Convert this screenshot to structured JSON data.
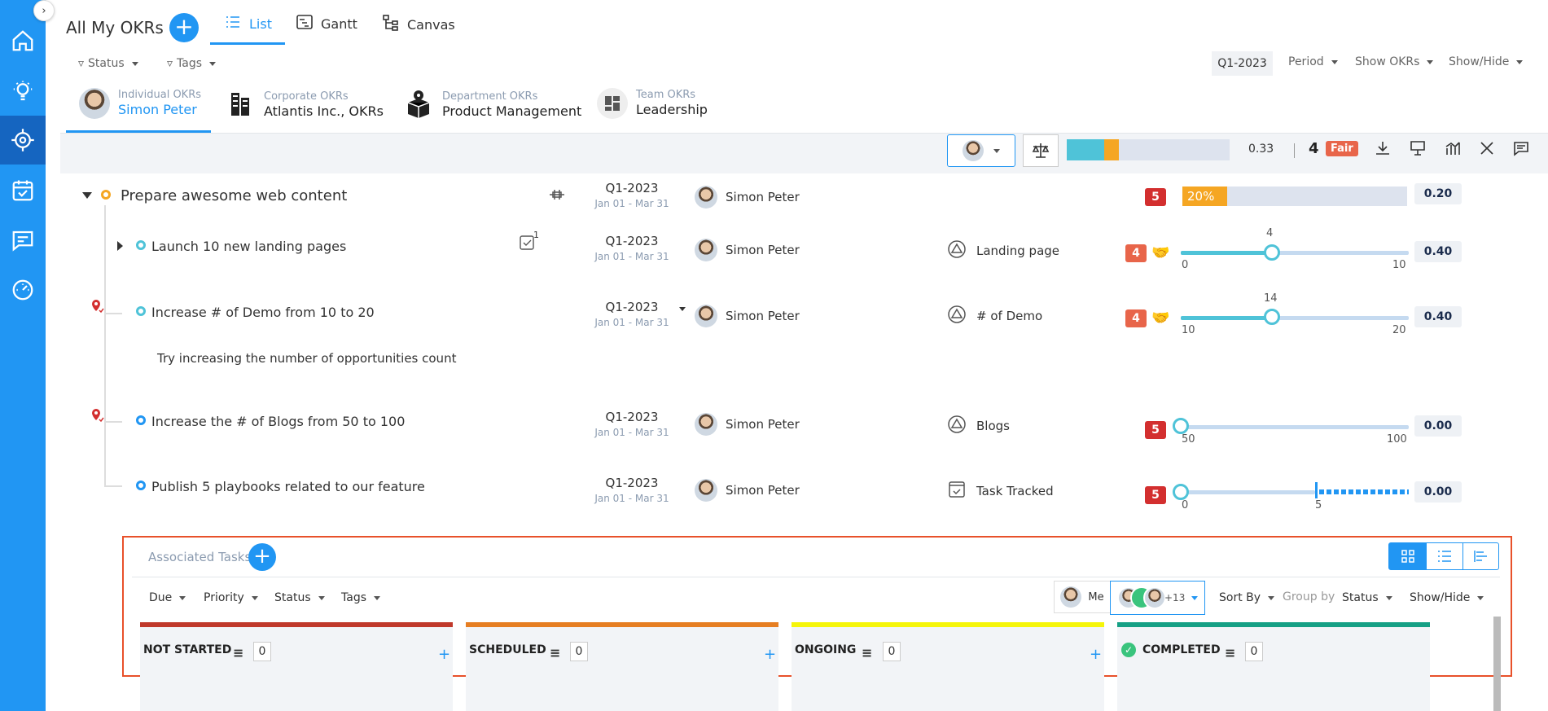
{
  "header": {
    "title": "All My OKRs",
    "views": [
      {
        "label": "List",
        "icon": "list-icon",
        "active": true
      },
      {
        "label": "Gantt",
        "icon": "gantt-icon",
        "active": false
      },
      {
        "label": "Canvas",
        "icon": "canvas-icon",
        "active": false
      }
    ]
  },
  "filters": {
    "status": "Status",
    "tags": "Tags"
  },
  "right_filters": {
    "period_value": "Q1-2023",
    "period": "Period",
    "show_okrs": "Show OKRs",
    "show_hide": "Show/Hide"
  },
  "okr_tabs": [
    {
      "sub": "Individual OKRs",
      "main": "Simon Peter",
      "active": true
    },
    {
      "sub": "Corporate OKRs",
      "main": "Atlantis Inc., OKRs"
    },
    {
      "sub": "Department OKRs",
      "main": "Product Management"
    },
    {
      "sub": "Team OKRs",
      "main": "Leadership"
    }
  ],
  "toolbar": {
    "progress_value": "0.33",
    "rating_number": "4",
    "rating_label": "Fair",
    "progress_fill": 0.23
  },
  "objective": {
    "title": "Prepare awesome web content",
    "period": "Q1-2023",
    "dates": "Jan 01 - Mar 31",
    "owner": "Simon Peter",
    "badge": "5",
    "progress_label": "20%",
    "progress": 0.2,
    "score": "0.20"
  },
  "key_results": [
    {
      "title": "Launch 10 new landing pages",
      "period": "Q1-2023",
      "dates": "Jan 01 - Mar 31",
      "owner": "Simon Peter",
      "kpi": "Landing page",
      "badge": "4",
      "current": "4",
      "start": "0",
      "target": "10",
      "level": 0.4,
      "score": "0.40",
      "task_count": "1"
    },
    {
      "title": "Increase # of Demo from 10 to 20",
      "period": "Q1-2023",
      "dates": "Jan 01 - Mar 31",
      "owner": "Simon Peter",
      "kpi": "# of Demo",
      "badge": "4",
      "current": "14",
      "start": "10",
      "target": "20",
      "level": 0.4,
      "score": "0.40",
      "note": "Try increasing the number of opportunities count"
    },
    {
      "title": "Increase the # of Blogs from 50 to 100",
      "period": "Q1-2023",
      "dates": "Jan 01 - Mar 31",
      "owner": "Simon Peter",
      "kpi": "Blogs",
      "badge": "5",
      "start": "50",
      "target": "100",
      "level": 0,
      "score": "0.00"
    },
    {
      "title": "Publish 5 playbooks related to our feature",
      "period": "Q1-2023",
      "dates": "Jan 01 - Mar 31",
      "owner": "Simon Peter",
      "kpi": "Task Tracked",
      "badge": "5",
      "start": "0",
      "mid": "5",
      "level": 0,
      "score": "0.00"
    }
  ],
  "assoc": {
    "title": "Associated Tasks",
    "filters": {
      "due": "Due",
      "priority": "Priority",
      "status": "Status",
      "tags": "Tags"
    },
    "me": "Me",
    "plus_count": "+13",
    "sort_by": "Sort By",
    "group_by": "Group by",
    "group_value": "Status",
    "show_hide": "Show/Hide",
    "columns": [
      {
        "title": "NOT STARTED",
        "count": "0",
        "color": "#c0392b"
      },
      {
        "title": "SCHEDULED",
        "count": "0",
        "color": "#e67e22"
      },
      {
        "title": "ONGOING",
        "count": "0",
        "color": "#f5f50a"
      },
      {
        "title": "COMPLETED",
        "count": "0",
        "color": "#16a085"
      }
    ]
  },
  "colors": {
    "primary": "#2196f3",
    "badge_red": "#d32f2f",
    "badge_orange": "#e8654a",
    "progress_orange": "#f5a623"
  }
}
